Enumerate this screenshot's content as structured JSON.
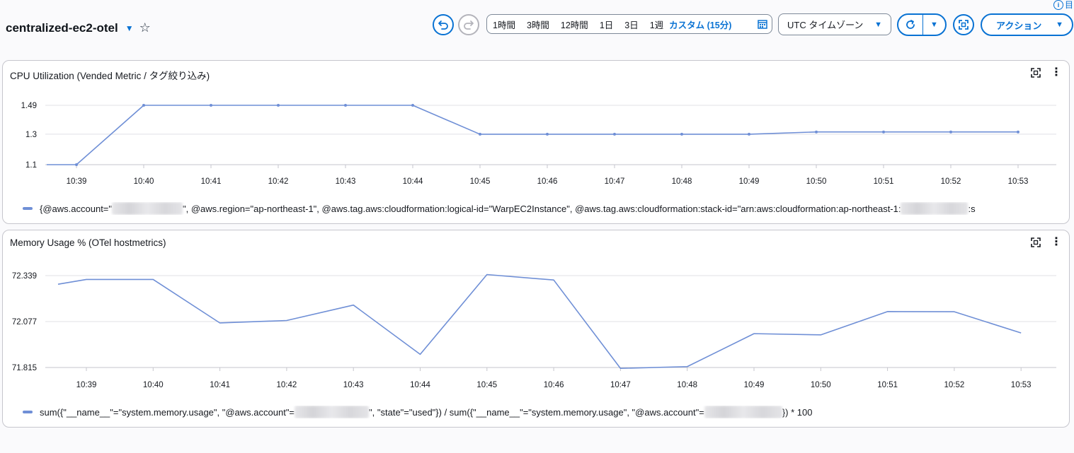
{
  "header": {
    "title": "centralized-ec2-otel",
    "info_label": "i",
    "info_text": "目",
    "range_options": [
      "1時間",
      "3時間",
      "12時間",
      "1日",
      "3日",
      "1週"
    ],
    "range_custom": "カスタム (15分)",
    "timezone": "UTC タイムゾーン",
    "action_label": "アクション",
    "accent_color": "#0972d3"
  },
  "widgets": [
    {
      "title": "CPU Utilization (Vended Metric / タグ絞り込み)",
      "legend_prefix": "{@aws.account=\"",
      "legend_middle": "\", @aws.region=\"ap-northeast-1\", @aws.tag.aws:cloudformation:logical-id=\"WarpEC2Instance\", @aws.tag.aws:cloudformation:stack-id=\"arn:aws:cloudformation:ap-northeast-1:",
      "legend_suffix": ":s",
      "legend_color": "#6f8fd6"
    },
    {
      "title": "Memory Usage % (OTel hostmetrics)",
      "legend_prefix": "sum({\"__name__\"=\"system.memory.usage\", \"@aws.account\"=",
      "legend_middle": "\", \"state\"=\"used\"}) / sum({\"__name__\"=\"system.memory.usage\", \"@aws.account\"=",
      "legend_suffix": "}) * 100",
      "legend_color": "#6f8fd6"
    }
  ],
  "chart_data": [
    {
      "type": "line",
      "title": "CPU Utilization (Vended Metric / タグ絞り込み)",
      "x": [
        "10:38.4",
        "10:39",
        "10:40",
        "10:41",
        "10:42",
        "10:43",
        "10:44",
        "10:45",
        "10:46",
        "10:47",
        "10:48",
        "10:49",
        "10:50",
        "10:51",
        "10:52",
        "10:53"
      ],
      "x_ticks": [
        "10:39",
        "10:40",
        "10:41",
        "10:42",
        "10:43",
        "10:44",
        "10:45",
        "10:46",
        "10:47",
        "10:48",
        "10:49",
        "10:50",
        "10:51",
        "10:52",
        "10:53"
      ],
      "y_ticks": [
        "1.49",
        "1.3",
        "1.1"
      ],
      "ylim": [
        1.1,
        1.49
      ],
      "series": [
        {
          "values": [
            1.1,
            1.1,
            1.49,
            1.49,
            1.49,
            1.49,
            1.49,
            1.3,
            1.3,
            1.3,
            1.3,
            1.3,
            1.315,
            1.315,
            1.315,
            1.315
          ],
          "markers": true
        }
      ],
      "grid": true
    },
    {
      "type": "line",
      "title": "Memory Usage % (OTel hostmetrics)",
      "x_ticks": [
        "10:39",
        "10:40",
        "10:41",
        "10:42",
        "10:43",
        "10:44",
        "10:45",
        "10:46",
        "10:47",
        "10:48",
        "10:49",
        "10:50",
        "10:51",
        "10:52",
        "10:53"
      ],
      "y_ticks": [
        "72.339",
        "72.077",
        "71.815"
      ],
      "ylim": [
        71.815,
        72.339
      ],
      "series": [
        {
          "values": [
            72.29,
            72.317,
            72.317,
            72.069,
            72.083,
            72.171,
            71.89,
            72.345,
            72.314,
            71.81,
            71.82,
            72.008,
            72.001,
            72.134,
            72.133,
            72.012
          ],
          "markers": false
        }
      ],
      "grid": true
    }
  ]
}
